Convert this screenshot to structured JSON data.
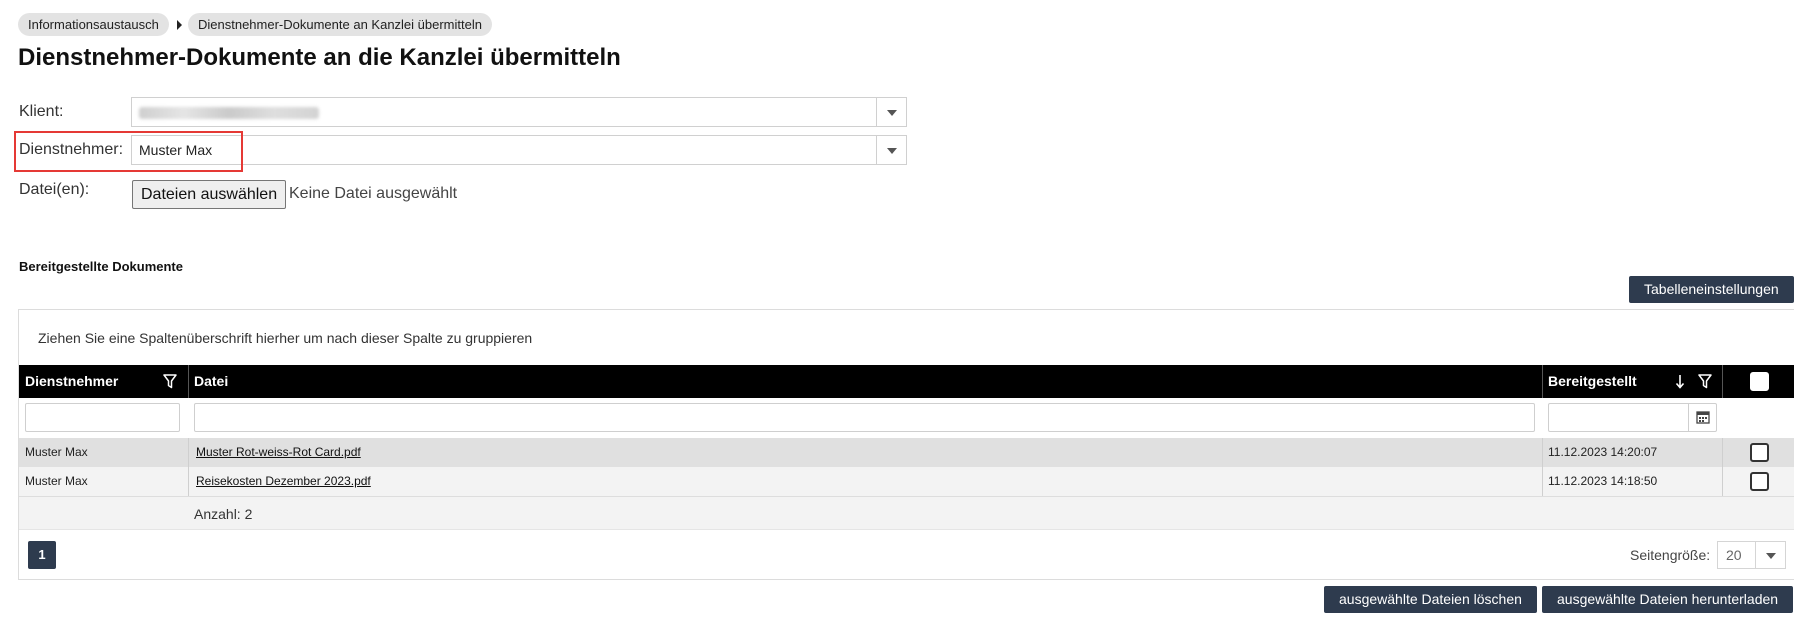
{
  "breadcrumb": {
    "items": [
      "Informationsaustausch",
      "Dienstnehmer-Dokumente an Kanzlei übermitteln"
    ]
  },
  "page": {
    "title": "Dienstnehmer-Dokumente an die Kanzlei übermitteln"
  },
  "form": {
    "client_label": "Klient:",
    "employee_label": "Dienstnehmer:",
    "employee_value": "Muster Max",
    "files_label": "Datei(en):",
    "choose_files_button": "Dateien auswählen",
    "no_file_text": "Keine Datei ausgewählt"
  },
  "section": {
    "title": "Bereitgestellte Dokumente",
    "table_settings_button": "Tabelleneinstellungen"
  },
  "grid": {
    "group_hint": "Ziehen Sie eine Spaltenüberschrift hierher um nach dieser Spalte zu gruppieren",
    "columns": {
      "employee": "Dienstnehmer",
      "file": "Datei",
      "provided": "Bereitgestellt"
    },
    "rows": [
      {
        "employee": "Muster Max",
        "file": "Muster Rot-weiss-Rot Card.pdf",
        "provided": "11.12.2023 14:20:07"
      },
      {
        "employee": "Muster Max",
        "file": "Reisekosten Dezember 2023.pdf",
        "provided": "11.12.2023 14:18:50"
      }
    ],
    "count_text": "Anzahl: 2",
    "current_page": "1",
    "page_size_label": "Seitengröße:",
    "page_size_value": "20"
  },
  "actions": {
    "delete_selected": "ausgewählte Dateien löschen",
    "download_selected": "ausgewählte Dateien herunterladen"
  },
  "colors": {
    "primary_button": "#2e3b4e",
    "header_bg": "#000000",
    "selected_row": "#e0e0e0",
    "highlight_box": "#e53935"
  }
}
